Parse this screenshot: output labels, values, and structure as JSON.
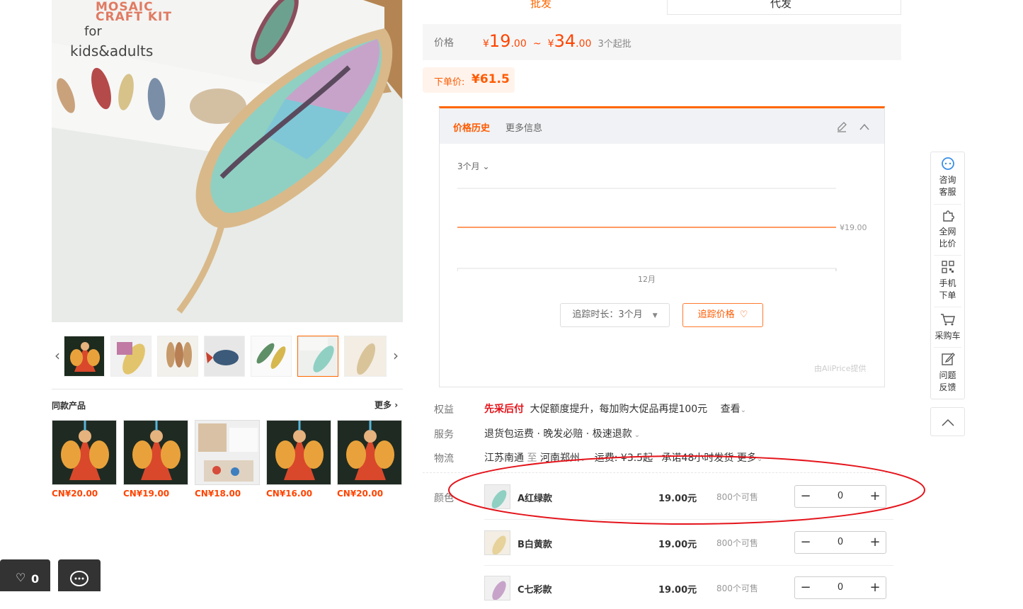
{
  "gallery": {
    "box_text_line1": "MOSAIC",
    "box_text_line2": "CRAFT KIT",
    "box_text_line3": "for",
    "box_text_line4": "kids&adults"
  },
  "same_products": {
    "title": "同款产品",
    "more": "更多",
    "items": [
      {
        "price": "CN¥20.00"
      },
      {
        "price": "CN¥19.00"
      },
      {
        "price": "CN¥18.00"
      },
      {
        "price": "CN¥16.00"
      },
      {
        "price": "CN¥20.00"
      }
    ]
  },
  "tabs": {
    "wholesale": "批发",
    "dropship": "代发"
  },
  "price": {
    "label": "价格",
    "currency": "¥",
    "low_int": "19",
    "low_dec": ".00",
    "sep": "~",
    "high_int": "34",
    "high_dec": ".00",
    "moq": "3个起批"
  },
  "order_price": {
    "label": "下单价:",
    "value": "¥61.5"
  },
  "price_history": {
    "tab_active": "价格历史",
    "tab_more": "更多信息",
    "range": "3个月",
    "price_line_label": "¥19.00",
    "x_label": "12月",
    "track_duration": "追踪时长：3个月",
    "track_button": "追踪价格",
    "provider": "由AliPrice提供"
  },
  "rows": {
    "rights_label": "权益",
    "rights_badge": "先采后付",
    "rights_text": "大促额度提升，每加购大促品再提100元",
    "rights_view": "查看",
    "service_label": "服务",
    "service_text": "退货包运费 · 晚发必赔 · 极速退款",
    "logistics_label": "物流",
    "logistics_from": "江苏南通",
    "logistics_to_word": "至",
    "logistics_to": "河南郑州",
    "logistics_fee": "运费: ¥3.5起",
    "logistics_promise": "承诺48小时发货",
    "logistics_more": "更多",
    "color_label": "颜色"
  },
  "skus": [
    {
      "name": "A红绿款",
      "price": "19.00元",
      "stock": "800个可售",
      "qty": "0"
    },
    {
      "name": "B白黄款",
      "price": "19.00元",
      "stock": "800个可售",
      "qty": "0"
    },
    {
      "name": "C七彩款",
      "price": "19.00元",
      "stock": "800个可售",
      "qty": "0"
    }
  ],
  "sidebar": {
    "consult": [
      "咨询",
      "客服"
    ],
    "compare": [
      "全网",
      "比价"
    ],
    "mobile": [
      "手机",
      "下单"
    ],
    "cart": "采购车",
    "feedback": [
      "问题",
      "反馈"
    ]
  },
  "bottom_bar": {
    "fav_count": "0"
  },
  "colors": {
    "accent": "#ff5a00",
    "price_red": "#f40",
    "annotation": "#e4141b"
  }
}
